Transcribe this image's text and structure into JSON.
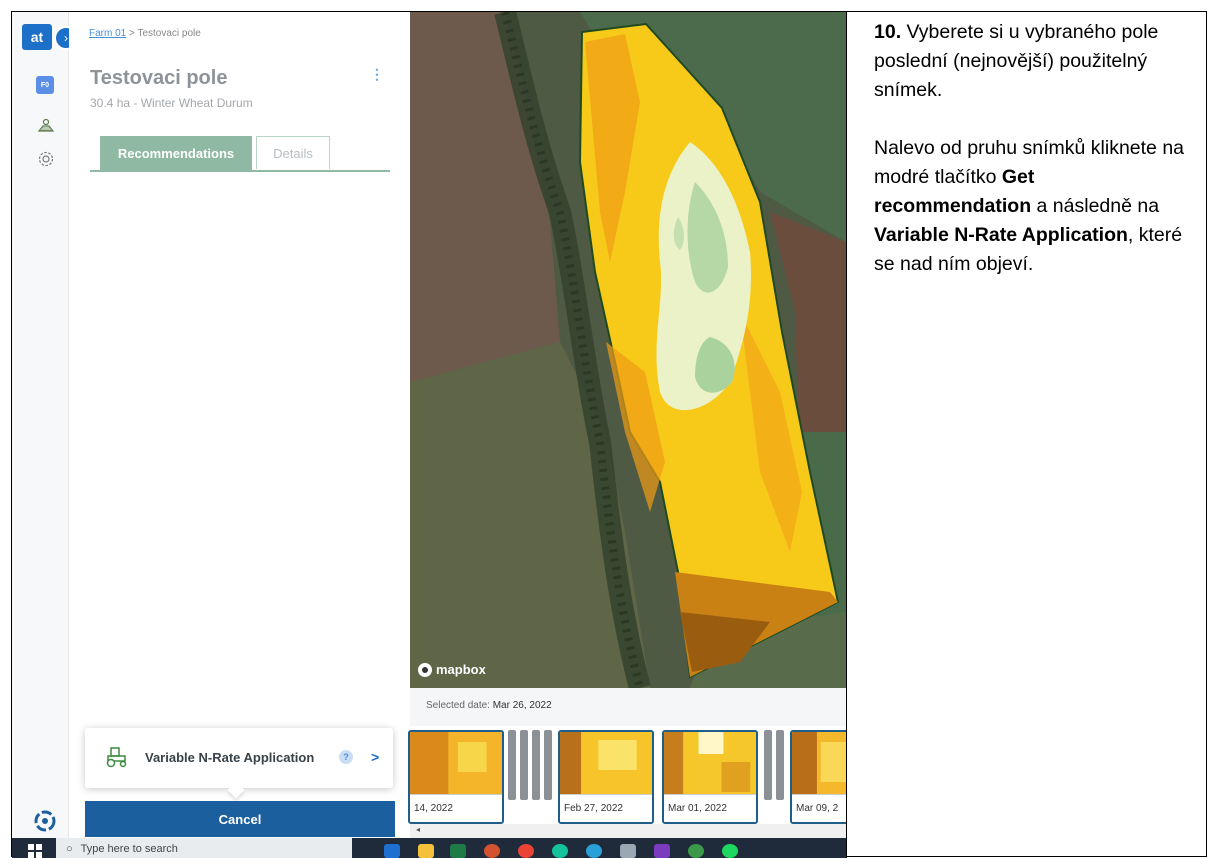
{
  "app": {
    "logo_text": "at",
    "farm_badge": "F0",
    "breadcrumb": {
      "farm": "Farm 01",
      "separator": ">",
      "field": "Testovaci pole"
    }
  },
  "field": {
    "title": "Testovaci pole",
    "subtitle": "30.4 ha - Winter Wheat Durum"
  },
  "tabs": [
    {
      "label": "Recommendations",
      "active": true
    },
    {
      "label": "Details",
      "active": false
    }
  ],
  "popup": {
    "label": "Variable N-Rate Application",
    "help": "?",
    "chevron": ">"
  },
  "cancel_label": "Cancel",
  "map": {
    "attribution": "mapbox",
    "selected_prefix": "Selected date:",
    "selected_date": "Mar 26, 2022"
  },
  "timeline": [
    {
      "date": "14, 2022"
    },
    {
      "date": "Feb 27, 2022"
    },
    {
      "date": "Mar 01, 2022"
    },
    {
      "date": "Mar 09, 2"
    }
  ],
  "taskbar": {
    "search_placeholder": "Type here to search"
  },
  "instructions": {
    "step_number": "10.",
    "step_text": " Vyberete si u vybraného pole poslední (nejnovější) použitelný snímek.",
    "p2_a": "Nalevo od pruhu snímků kliknete na modré tlačítko ",
    "p2_bold1": "Get recommendation",
    "p2_b": " a následně na ",
    "p2_bold2": "Variable N-Rate Application",
    "p2_c": ", které se nad ním objeví."
  },
  "colors": {
    "accent_blue": "#1c70c8",
    "tab_green": "#8fb9a2",
    "cancel_blue": "#1c5f9e",
    "thumb_border": "#1f5e8a"
  }
}
